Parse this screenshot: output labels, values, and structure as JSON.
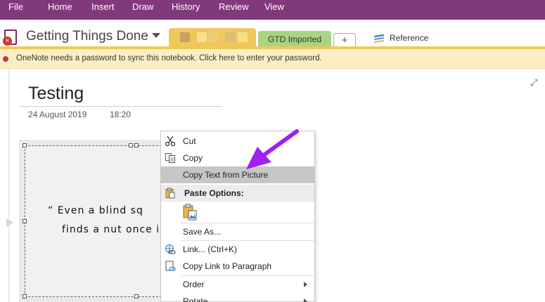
{
  "menu": [
    "File",
    "Home",
    "Insert",
    "Draw",
    "History",
    "Review",
    "View"
  ],
  "notebook": {
    "title": "Getting Things Done",
    "tabs": {
      "green": "GTD Imported",
      "plus": "+",
      "reference": "Reference"
    }
  },
  "notification": {
    "message": "OneNote needs a password to sync this notebook. Click here to enter your password."
  },
  "page": {
    "title": "Testing",
    "date": "24 August 2019",
    "time": "18:20",
    "image_text": {
      "line1": "“ Even a blind sq",
      "line2": "finds a nut once i"
    }
  },
  "context_menu": {
    "cut": "Cut",
    "copy": "Copy",
    "copy_text_from_picture": "Copy Text from Picture",
    "paste_options": "Paste Options:",
    "save_as": "Save As...",
    "link": "Link...  (Ctrl+K)",
    "copy_link": "Copy Link to Paragraph",
    "order": "Order",
    "rotate": "Rotate"
  },
  "colors": {
    "ribbon": "#80397b",
    "section_yellow": "#f0c75a",
    "section_green": "#a9d481",
    "notification_bg": "#fbeec3",
    "annotation_arrow": "#a020f0"
  },
  "icons": {
    "notebook": "notebook-error-icon",
    "cut": "scissors-icon",
    "copy": "copy-icon",
    "paste": "clipboard-icon",
    "link": "link-globe-icon",
    "copy_link": "document-link-icon",
    "expand": "expand-icon"
  }
}
